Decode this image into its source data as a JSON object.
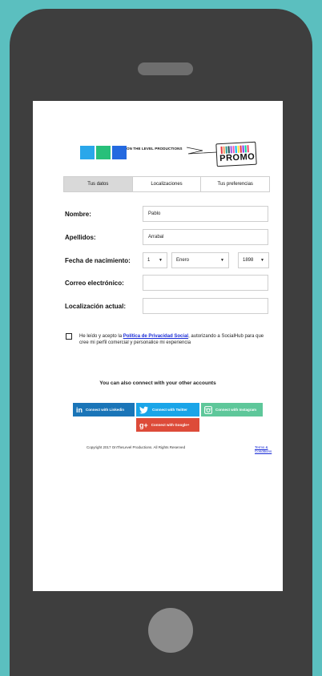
{
  "header": {
    "brand": "ON THE LEVEL PRODUCTIONS",
    "promo": "PROMO",
    "blocks": [
      "#2aa7ea",
      "#28c07a",
      "#2469e0"
    ]
  },
  "tabs": [
    {
      "label": "Tus datos",
      "active": true
    },
    {
      "label": "Localizaciones",
      "active": false
    },
    {
      "label": "Tus preferencias",
      "active": false
    }
  ],
  "form": {
    "nombre_label": "Nombre:",
    "nombre_value": "Pablo",
    "apellidos_label": "Apellidos:",
    "apellidos_value": "Arrabal",
    "fecha_label": "Fecha de nacimiento:",
    "day": "1",
    "month": "Enero",
    "year": "1898",
    "correo_label": "Correo electrónico:",
    "correo_value": "",
    "localizacion_label": "Localización actual:",
    "localizacion_value": ""
  },
  "consent": {
    "prefix": "He leído y acepto la ",
    "link": "Política de Privacidad Social",
    "suffix": ", autorizando a SocialHub para que cree mi perfil comercial y personalice mi experiencia",
    "checked": false
  },
  "connect": {
    "title": "You can also connect with your other accounts",
    "linkedin": "Connect with Linkedin",
    "twitter": "Connect with Twitter",
    "instagram": "Connect with Instagram",
    "google": "Connect with Google+",
    "colors": {
      "linkedin": "#1a75b8",
      "twitter": "#1aa5e8",
      "instagram": "#5ec79a",
      "google": "#dd4b39"
    }
  },
  "footer": {
    "copyright": "Copyright 2017 OnTheLevel Productions. All Rights Reserved",
    "terms": "Terms & Conditions"
  }
}
